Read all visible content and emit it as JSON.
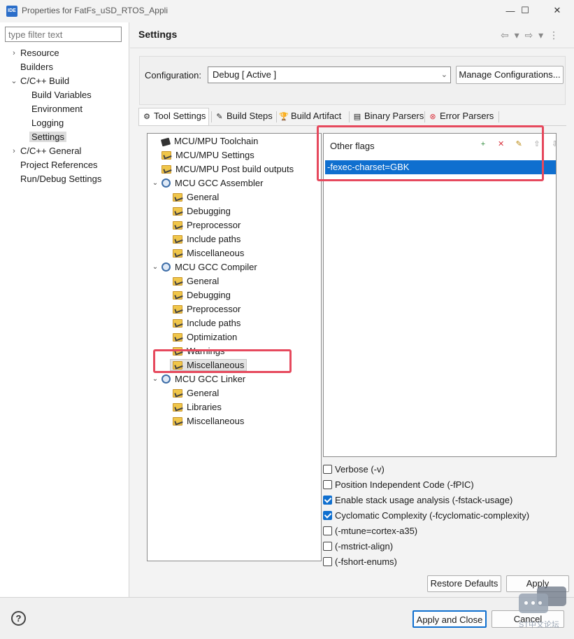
{
  "window": {
    "logo_text": "IDE",
    "title": "Properties for FatFs_uSD_RTOS_Appli",
    "minimize": "—",
    "maximize": "☐",
    "close": "✕"
  },
  "sidebar": {
    "filter_placeholder": "type filter text",
    "items": [
      {
        "label": "Resource",
        "toggle": "›"
      },
      {
        "label": "Builders"
      },
      {
        "label": "C/C++ Build",
        "toggle": "⌄"
      },
      {
        "label": "Build Variables"
      },
      {
        "label": "Environment"
      },
      {
        "label": "Logging"
      },
      {
        "label": "Settings"
      },
      {
        "label": "C/C++ General",
        "toggle": "›"
      },
      {
        "label": "Project References"
      },
      {
        "label": "Run/Debug Settings"
      }
    ]
  },
  "header": {
    "title": "Settings",
    "nav": "⇦ ▾ ⇨ ▾ ⋮"
  },
  "configuration": {
    "label": "Configuration:",
    "value": "Debug  [ Active ]",
    "chevron": "⌄",
    "manage_label": "Manage Configurations..."
  },
  "tabs": [
    {
      "label": "Tool Settings",
      "icon": "⚙"
    },
    {
      "label": "Build Steps",
      "icon": "✎"
    },
    {
      "label": "Build Artifact",
      "icon": "🏆"
    },
    {
      "label": "Binary Parsers",
      "icon": "▤"
    },
    {
      "label": "Error Parsers",
      "icon": "⊗"
    }
  ],
  "tool_tree": [
    {
      "label": "MCU/MPU Toolchain"
    },
    {
      "label": "MCU/MPU Settings"
    },
    {
      "label": "MCU/MPU Post build outputs"
    },
    {
      "label": "MCU GCC Assembler",
      "toggle": "⌄"
    },
    {
      "label": "General"
    },
    {
      "label": "Debugging"
    },
    {
      "label": "Preprocessor"
    },
    {
      "label": "Include paths"
    },
    {
      "label": "Miscellaneous"
    },
    {
      "label": "MCU GCC Compiler",
      "toggle": "⌄"
    },
    {
      "label": "General"
    },
    {
      "label": "Debugging"
    },
    {
      "label": "Preprocessor"
    },
    {
      "label": "Include paths"
    },
    {
      "label": "Optimization"
    },
    {
      "label": "Warnings"
    },
    {
      "label": "Miscellaneous"
    },
    {
      "label": "MCU GCC Linker",
      "toggle": "⌄"
    },
    {
      "label": "General"
    },
    {
      "label": "Libraries"
    },
    {
      "label": "Miscellaneous"
    }
  ],
  "other_flags": {
    "label": "Other flags",
    "tools": [
      "+",
      "✕",
      "✎",
      "⇧",
      "⇩"
    ],
    "entries": [
      "-fexec-charset=GBK"
    ]
  },
  "options": [
    {
      "label": "Verbose (-v)",
      "checked": false
    },
    {
      "label": "Position Independent Code (-fPIC)",
      "checked": false
    },
    {
      "label": "Enable stack usage analysis (-fstack-usage)",
      "checked": true
    },
    {
      "label": "Cyclomatic Complexity (-fcyclomatic-complexity)",
      "checked": true
    },
    {
      "label": "(-mtune=cortex-a35)",
      "checked": false
    },
    {
      "label": "(-mstrict-align)",
      "checked": false
    },
    {
      "label": "(-fshort-enums)",
      "checked": false
    }
  ],
  "buttons": {
    "restore_defaults": "Restore Defaults",
    "apply": "Apply",
    "apply_and_close": "Apply and Close",
    "cancel": "Cancel",
    "help": "?"
  },
  "watermark": {
    "text": "ST中文论坛"
  },
  "colors": {
    "selection": "#0f6fcf",
    "highlight_box": "#e6495d"
  }
}
